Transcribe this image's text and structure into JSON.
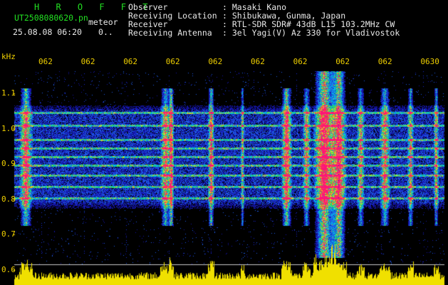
{
  "brand": "H R O F F T",
  "file": {
    "name": "UT2508080620.pn",
    "mode": "meteor",
    "timestamp": "25.08.08 06:20",
    "counter": "0",
    "counter_suffix": ".."
  },
  "header": {
    "rows": [
      {
        "label": "Observer",
        "sep": ":",
        "value": "Masaki Kano"
      },
      {
        "label": "Receiving Location",
        "sep": ":",
        "value": "Shibukawa, Gunma, Japan"
      },
      {
        "label": "Receiver",
        "sep": ":",
        "value": "RTL-SDR SDR# 43dB L15 103.2MHz CW"
      },
      {
        "label": "Receiving Antenna",
        "sep": ":",
        "value": "3el Yagi(V) Az 330 for Vladivostok"
      }
    ]
  },
  "spectrogram": {
    "y_unit": "kHz",
    "y_ticks": [
      "1.1",
      "1.0",
      "0.9",
      "0.8",
      "0.7",
      "0.6"
    ],
    "x_ticks": [
      "062",
      "062",
      "062",
      "062",
      "062",
      "062",
      "062",
      "062",
      "062",
      "0630"
    ],
    "colors": {
      "background": "#000000",
      "scale": "#f0d000",
      "text": "#e8e8e8",
      "brand": "#22e022"
    }
  }
}
